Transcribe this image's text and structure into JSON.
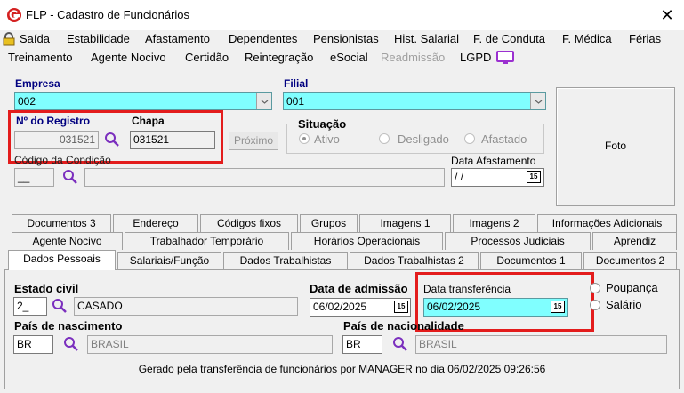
{
  "window": {
    "title": "FLP - Cadastro de Funcionários",
    "close_glyph": "✕"
  },
  "menu": {
    "row1": [
      "Saída",
      "Estabilidade",
      "Afastamento",
      "Dependentes",
      "Pensionistas",
      "Hist. Salarial",
      "F. de Conduta",
      "F. Médica",
      "Férias"
    ],
    "row2": [
      "Treinamento",
      "Agente Nocivo",
      "Certidão",
      "Reintegração",
      "eSocial",
      "Readmissão",
      "LGPD"
    ]
  },
  "empresa": {
    "label": "Empresa",
    "value": "002"
  },
  "filial": {
    "label": "Filial",
    "value": "001"
  },
  "registro": {
    "label": "Nº do Registro",
    "value": "031521"
  },
  "chapa": {
    "label": "Chapa",
    "value": "031521"
  },
  "proximo_label": "Próximo",
  "situacao": {
    "label": "Situação",
    "options": [
      "Ativo",
      "Desligado",
      "Afastado"
    ],
    "selected": "Ativo"
  },
  "foto_label": "Foto",
  "codigo_condicao": {
    "label": "Código da Condição",
    "value": "__"
  },
  "data_afastamento": {
    "label": "Data Afastamento",
    "value": "/ /"
  },
  "calendar_glyph": "15",
  "tabs": {
    "row1": [
      "Documentos 3",
      "Endereço",
      "Códigos fixos",
      "Grupos",
      "Imagens 1",
      "Imagens 2",
      "Informações Adicionais"
    ],
    "row2": [
      "Agente Nocivo",
      "Trabalhador Temporário",
      "Horários Operacionais",
      "Processos Judiciais",
      "Aprendiz"
    ],
    "row3": [
      "Dados Pessoais",
      "Salariais/Função",
      "Dados Trabalhistas",
      "Dados Trabalhistas 2",
      "Documentos 1",
      "Documentos 2"
    ],
    "active": "Dados Pessoais"
  },
  "estado_civil": {
    "label": "Estado civil",
    "code": "2_",
    "desc": "CASADO"
  },
  "data_admissao": {
    "label": "Data de admissão",
    "value": "06/02/2025"
  },
  "data_transferencia": {
    "label": "Data transferência",
    "value": "06/02/2025"
  },
  "pagamento": {
    "options": [
      "Poupança",
      "Salário"
    ]
  },
  "pais_nascimento": {
    "label": "País de nascimento",
    "code": "BR",
    "desc": "BRASIL"
  },
  "pais_nacionalidade": {
    "label": "País de nacionalidade",
    "code": "BR",
    "desc": "BRASIL"
  },
  "status_message": "Gerado pela transferência de funcionários por MANAGER no dia 06/02/2025 09:26:56",
  "colors": {
    "cyan_field": "#80ffff",
    "highlight_red": "#e31c1c",
    "logo_red": "#d42020",
    "link_blue": "#000080",
    "icon_purple": "#7b2fbe"
  }
}
